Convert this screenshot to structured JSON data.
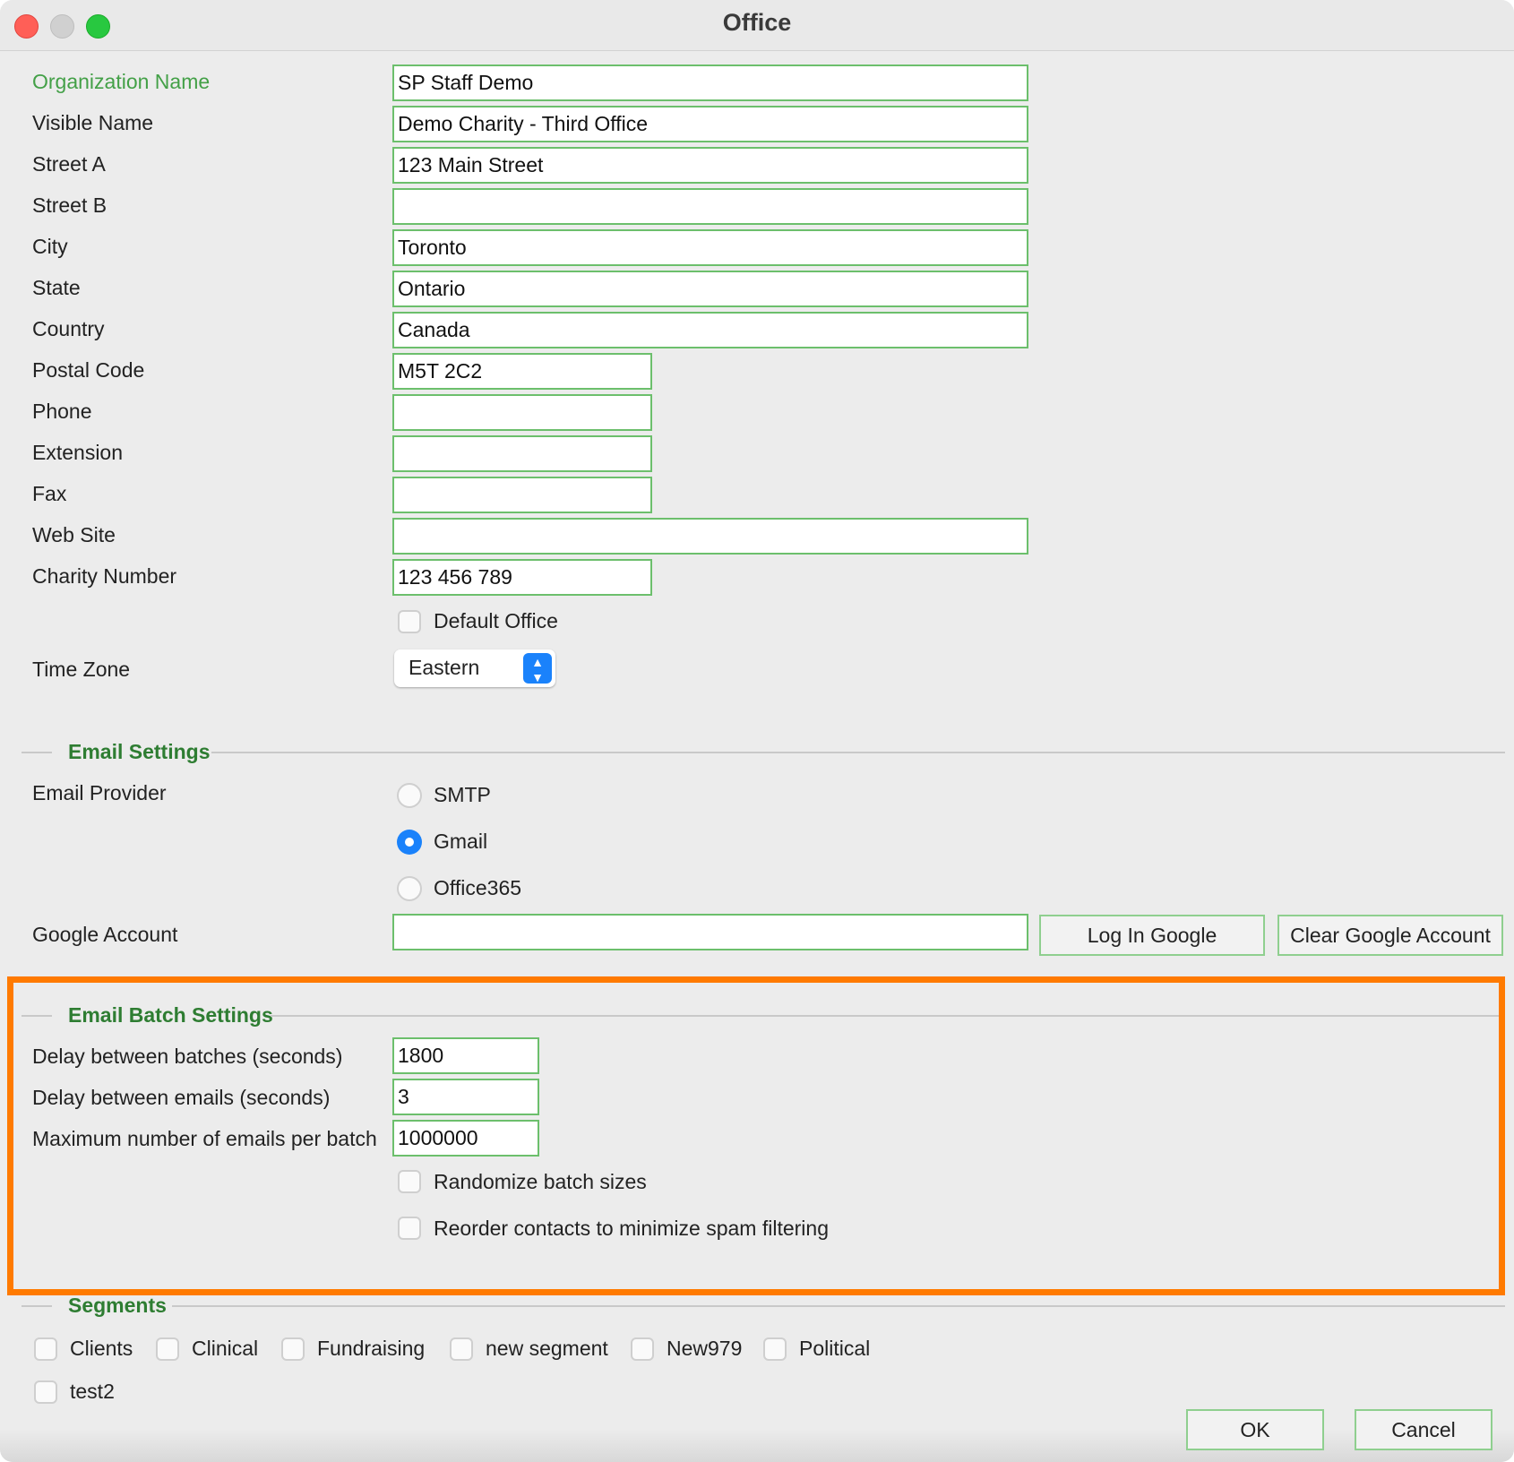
{
  "window": {
    "title": "Office"
  },
  "form": {
    "organization_name": {
      "label": "Organization Name",
      "value": "SP Staff Demo"
    },
    "visible_name": {
      "label": "Visible Name",
      "value": "Demo Charity - Third Office"
    },
    "street_a": {
      "label": "Street A",
      "value": "123 Main Street"
    },
    "street_b": {
      "label": "Street B",
      "value": ""
    },
    "city": {
      "label": "City",
      "value": "Toronto"
    },
    "state": {
      "label": "State",
      "value": "Ontario"
    },
    "country": {
      "label": "Country",
      "value": "Canada"
    },
    "postal_code": {
      "label": "Postal Code",
      "value": "M5T 2C2"
    },
    "phone": {
      "label": "Phone",
      "value": ""
    },
    "extension": {
      "label": "Extension",
      "value": ""
    },
    "fax": {
      "label": "Fax",
      "value": ""
    },
    "web_site": {
      "label": "Web Site",
      "value": ""
    },
    "charity_number": {
      "label": "Charity Number",
      "value": "123 456 789"
    },
    "default_office": {
      "label": "Default Office",
      "checked": false
    },
    "time_zone": {
      "label": "Time Zone",
      "value": "Eastern"
    }
  },
  "email_settings": {
    "title": "Email Settings",
    "provider_label": "Email Provider",
    "providers": [
      {
        "label": "SMTP",
        "selected": false
      },
      {
        "label": "Gmail",
        "selected": true
      },
      {
        "label": "Office365",
        "selected": false
      }
    ],
    "google_account": {
      "label": "Google Account",
      "value": ""
    },
    "login_google_label": "Log In Google",
    "clear_google_label": "Clear Google Account"
  },
  "email_batch_settings": {
    "title": "Email Batch Settings",
    "delay_batches": {
      "label": "Delay between batches (seconds)",
      "value": "1800"
    },
    "delay_emails": {
      "label": "Delay between emails (seconds)",
      "value": "3"
    },
    "max_emails": {
      "label": "Maximum number of emails per batch",
      "value": "1000000"
    },
    "randomize": {
      "label": "Randomize batch sizes",
      "checked": false
    },
    "reorder": {
      "label": "Reorder contacts to minimize spam filtering",
      "checked": false
    }
  },
  "segments": {
    "title": "Segments",
    "items": [
      {
        "label": "Clients",
        "checked": false
      },
      {
        "label": "Clinical",
        "checked": false
      },
      {
        "label": "Fundraising",
        "checked": false
      },
      {
        "label": "new segment",
        "checked": false
      },
      {
        "label": "New979",
        "checked": false
      },
      {
        "label": "Political",
        "checked": false
      },
      {
        "label": "test2",
        "checked": false
      }
    ]
  },
  "footer": {
    "ok_label": "OK",
    "cancel_label": "Cancel"
  },
  "colors": {
    "accent": "#1a82fb",
    "field_border": "#6cbf6c",
    "section_title": "#2e7d32",
    "highlight": "#ff7a00"
  }
}
